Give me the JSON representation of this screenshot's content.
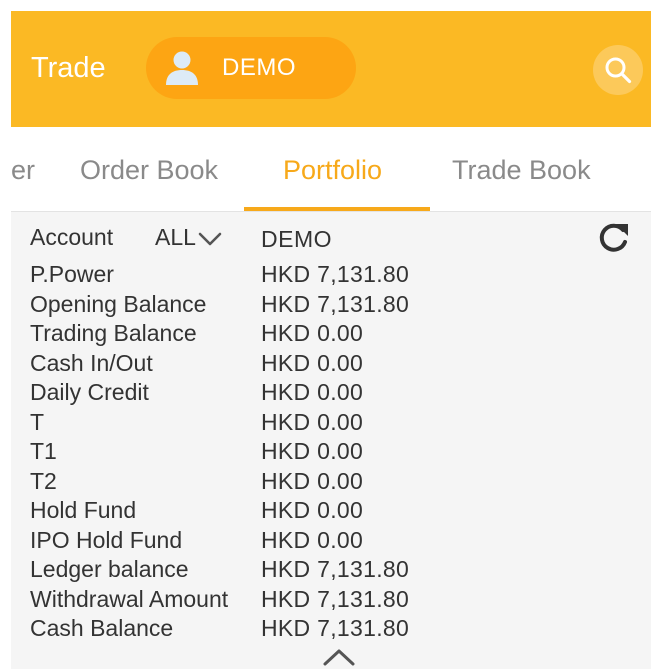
{
  "header": {
    "title": "Trade",
    "account_badge": "DEMO",
    "icons": {
      "avatar": "person-avatar-icon",
      "search": "search-icon"
    },
    "colors": {
      "header_bg": "#fbb924",
      "pill_bg": "#fda513",
      "accent": "#f7a91a"
    }
  },
  "tabs": [
    {
      "label": "ler",
      "active": false
    },
    {
      "label": "Order Book",
      "active": false
    },
    {
      "label": "Portfolio",
      "active": true
    },
    {
      "label": "Trade Book",
      "active": false
    }
  ],
  "portfolio": {
    "account_label": "Account",
    "account_selector": "ALL",
    "account_name": "DEMO",
    "rows": [
      {
        "label": "P.Power",
        "value": "HKD 7,131.80"
      },
      {
        "label": "Opening Balance",
        "value": "HKD 7,131.80"
      },
      {
        "label": "Trading Balance",
        "value": "HKD 0.00"
      },
      {
        "label": "Cash In/Out",
        "value": "HKD 0.00"
      },
      {
        "label": "Daily Credit",
        "value": "HKD 0.00"
      },
      {
        "label": "T",
        "value": "HKD 0.00"
      },
      {
        "label": "T1",
        "value": "HKD 0.00"
      },
      {
        "label": "T2",
        "value": "HKD 0.00"
      },
      {
        "label": "Hold Fund",
        "value": "HKD 0.00"
      },
      {
        "label": "IPO Hold Fund",
        "value": "HKD 0.00"
      },
      {
        "label": "Ledger balance",
        "value": "HKD 7,131.80"
      },
      {
        "label": "Withdrawal Amount",
        "value": "HKD 7,131.80"
      },
      {
        "label": "Cash Balance",
        "value": "HKD 7,131.80"
      }
    ]
  }
}
